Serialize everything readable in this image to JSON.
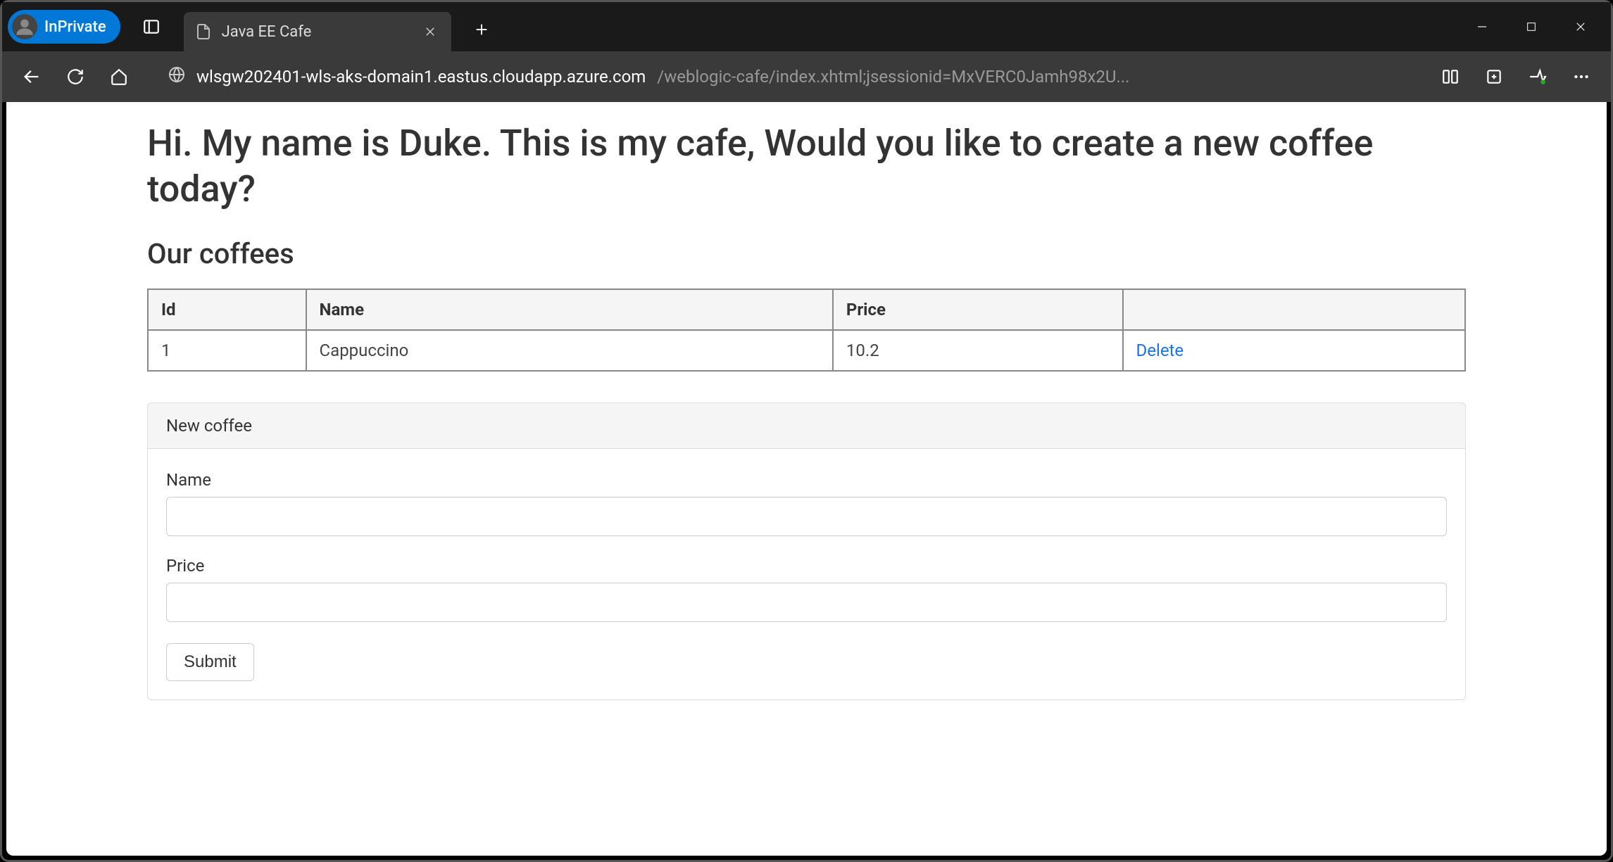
{
  "browser": {
    "inprivate_label": "InPrivate",
    "tab_title": "Java EE Cafe",
    "url_primary": "wlsgw202401-wls-aks-domain1.eastus.cloudapp.azure.com",
    "url_secondary": "/weblogic-cafe/index.xhtml;jsessionid=MxVERC0Jamh98x2U..."
  },
  "page": {
    "heading": "Hi. My name is Duke. This is my cafe, Would you like to create a new coffee today?",
    "subheading": "Our coffees",
    "table": {
      "headers": {
        "id": "Id",
        "name": "Name",
        "price": "Price",
        "action": ""
      },
      "rows": [
        {
          "id": "1",
          "name": "Cappuccino",
          "price": "10.2",
          "action": "Delete"
        }
      ]
    },
    "form": {
      "panel_title": "New coffee",
      "name_label": "Name",
      "name_value": "",
      "price_label": "Price",
      "price_value": "",
      "submit_label": "Submit"
    }
  }
}
